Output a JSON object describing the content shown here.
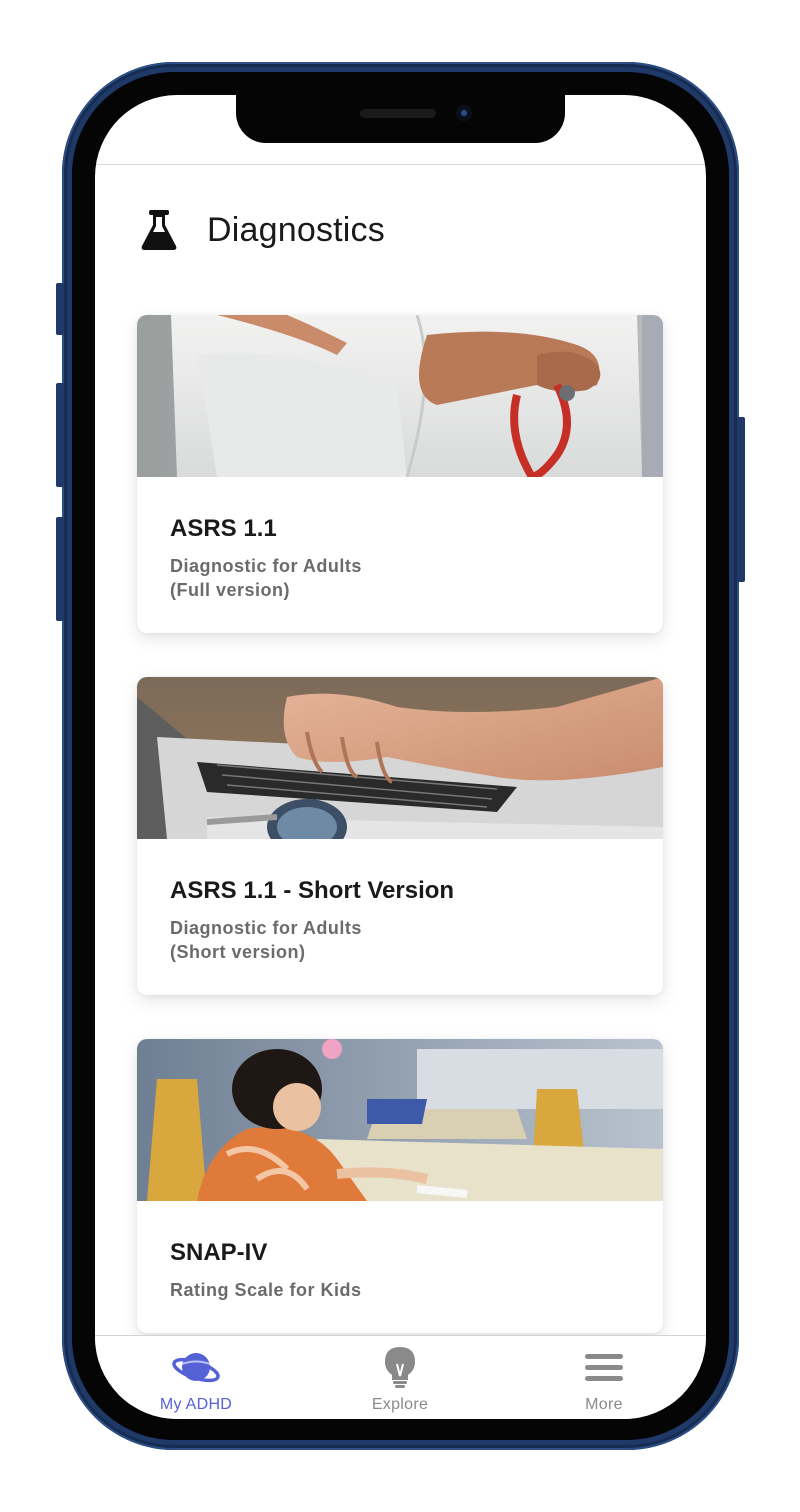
{
  "header": {
    "title": "Diagnostics",
    "icon": "flask-icon"
  },
  "cards": [
    {
      "title": "ASRS 1.1",
      "subtitle_line1": "Diagnostic for Adults",
      "subtitle_line2": "(Full version)",
      "image": "doctor-with-stethoscope-image"
    },
    {
      "title": "ASRS 1.1 - Short Version",
      "subtitle_line1": "Diagnostic for Adults",
      "subtitle_line2": "(Short version)",
      "image": "hands-typing-laptop-image"
    },
    {
      "title": "SNAP-IV",
      "subtitle_line1": "Rating Scale for Kids",
      "subtitle_line2": "",
      "image": "child-drawing-at-desk-image"
    }
  ],
  "tabs": [
    {
      "label": "My ADHD",
      "icon": "planet-icon",
      "active": true
    },
    {
      "label": "Explore",
      "icon": "lightbulb-icon",
      "active": false
    },
    {
      "label": "More",
      "icon": "menu-icon",
      "active": false
    }
  ],
  "colors": {
    "accent": "#5561d6",
    "inactive_tab": "#8a8a8a",
    "phone_frame": "#1f3a68",
    "title_text": "#1a1a1a",
    "subtitle_text": "#6b6b6b"
  }
}
